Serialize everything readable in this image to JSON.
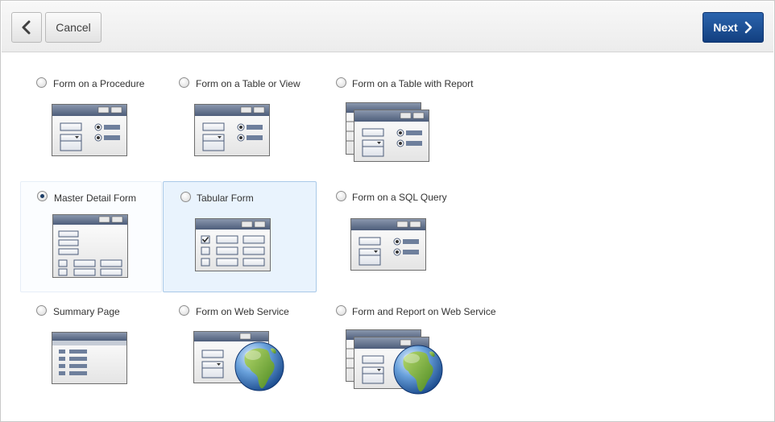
{
  "toolbar": {
    "back_icon": "chevron-left-icon",
    "cancel_label": "Cancel",
    "next_label": "Next",
    "next_icon": "chevron-right-icon"
  },
  "options": [
    {
      "label": "Form on a Procedure",
      "icon": "form-icon",
      "selected": false
    },
    {
      "label": "Form on a Table or View",
      "icon": "form-icon",
      "selected": false
    },
    {
      "label": "Form on a Table with Report",
      "icon": "form-report-icon",
      "selected": false
    },
    {
      "label": "Master Detail Form",
      "icon": "master-detail-icon",
      "selected": true
    },
    {
      "label": "Tabular Form",
      "icon": "tabular-form-icon",
      "selected": false
    },
    {
      "label": "Form on a SQL Query",
      "icon": "form-icon",
      "selected": false
    },
    {
      "label": "Summary Page",
      "icon": "summary-page-icon",
      "selected": false
    },
    {
      "label": "Form on Web Service",
      "icon": "web-service-form-icon",
      "selected": false
    },
    {
      "label": "Form and Report on Web Service",
      "icon": "web-service-form-report-icon",
      "selected": false
    }
  ],
  "colors": {
    "accent": "#1d4f91",
    "window_titlebar": "#5b6b86",
    "selected_radio": "#1c3d66",
    "hover_background": "#e9f3fd"
  }
}
